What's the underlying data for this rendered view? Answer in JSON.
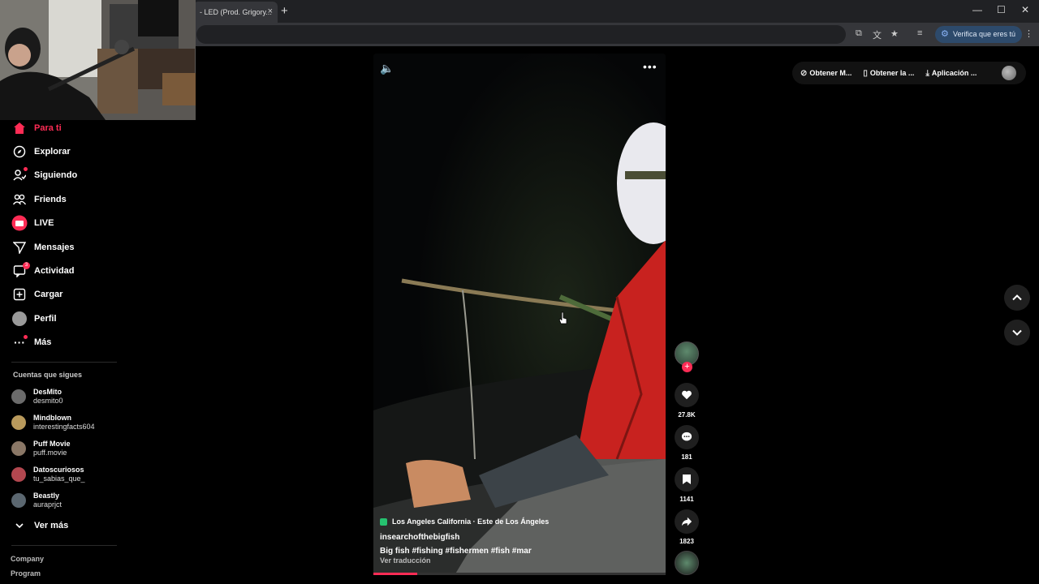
{
  "browser": {
    "tab_title": "- LED (Prod. Grigory...",
    "tab_close": "×",
    "new_tab": "+",
    "verify_label": "Verifica que eres tú"
  },
  "sidebar": {
    "items": [
      {
        "label": "Para ti",
        "icon": "home-icon",
        "active": true
      },
      {
        "label": "Explorar",
        "icon": "compass-icon"
      },
      {
        "label": "Siguiendo",
        "icon": "following-icon"
      },
      {
        "label": "Friends",
        "icon": "friends-icon"
      },
      {
        "label": "LIVE",
        "icon": "live-icon"
      },
      {
        "label": "Mensajes",
        "icon": "messages-icon"
      },
      {
        "label": "Actividad",
        "icon": "activity-icon",
        "badge": "3"
      },
      {
        "label": "Cargar",
        "icon": "upload-icon"
      },
      {
        "label": "Perfil",
        "icon": "profile-icon"
      },
      {
        "label": "Más",
        "icon": "more-icon"
      }
    ],
    "following_title": "Cuentas que sigues",
    "accounts": [
      {
        "name": "DesMito",
        "handle": "desmito0",
        "color": "#6b6b6b"
      },
      {
        "name": "Mindblown",
        "handle": "interestingfacts604",
        "color": "#b99a5c"
      },
      {
        "name": "Puff Movie",
        "handle": "puff.movie",
        "color": "#8a7766"
      },
      {
        "name": "Datoscuriosos",
        "handle": "tu_sabias_que_",
        "color": "#b2474f"
      },
      {
        "name": "Beastly",
        "handle": "auraprjct",
        "color": "#5b6770"
      }
    ],
    "see_more": "Ver más",
    "footer": [
      "Company",
      "Program"
    ]
  },
  "top_buttons": {
    "get_m": "Obtener M...",
    "get_la": "Obtener la ...",
    "app": "Aplicación ..."
  },
  "video": {
    "location": "Los Angeles California · Este de Los Ángeles",
    "author": "insearchofthebigfish",
    "description": "Big fish #fishing  #fishermen  #fish  #mar",
    "translate": "Ver traducción",
    "progress": 0.15
  },
  "actions": {
    "likes": "27.8K",
    "comments": "181",
    "saves": "1141",
    "shares": "1823"
  },
  "colors": {
    "accent": "#fe2c55",
    "background": "#000000"
  }
}
